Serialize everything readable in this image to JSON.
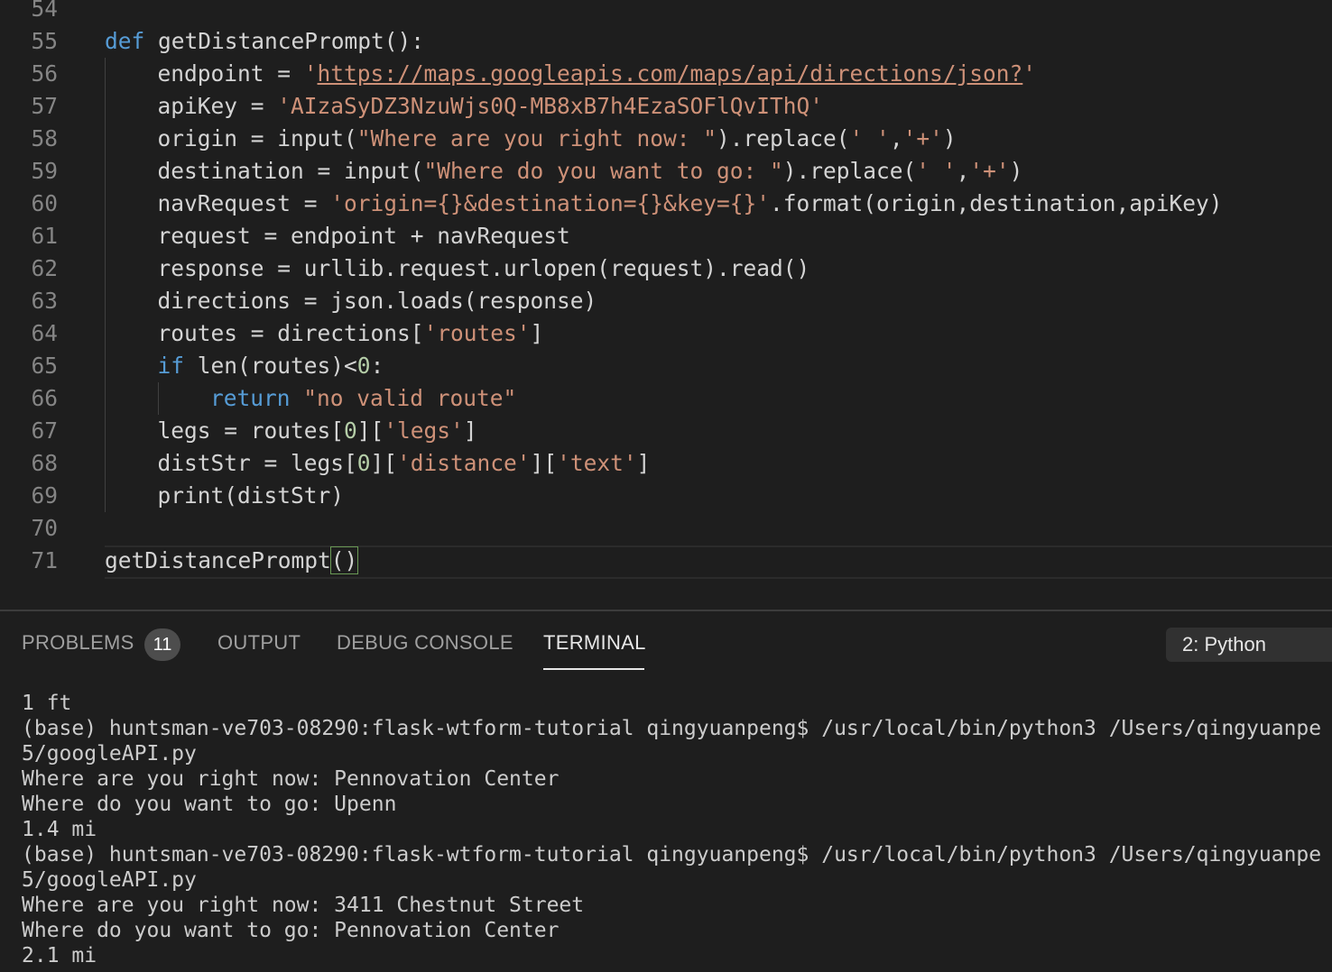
{
  "editor": {
    "lines": [
      {
        "n": "54",
        "segs": []
      },
      {
        "n": "55",
        "segs": [
          [
            "kw",
            "def"
          ],
          [
            "",
            "getDistancePrompt():"
          ]
        ]
      },
      {
        "n": "56",
        "segs": [
          [
            "",
            "endpoint = "
          ],
          [
            "str",
            "'"
          ],
          [
            "url",
            "https://maps.googleapis.com/maps/api/directions/json?"
          ],
          [
            "str",
            "'"
          ]
        ]
      },
      {
        "n": "57",
        "segs": [
          [
            "",
            "apiKey = "
          ],
          [
            "str",
            "'AIzaSyDZ3NzuWjs0Q-MB8xB7h4EzaSOFlQvIThQ'"
          ]
        ]
      },
      {
        "n": "58",
        "segs": [
          [
            "",
            "origin = input("
          ],
          [
            "str",
            "\"Where are you right now: \""
          ],
          [
            "",
            ").replace("
          ],
          [
            "str",
            "' '"
          ],
          [
            "",
            ","
          ],
          [
            "str",
            "'+'"
          ],
          [
            "",
            ")"
          ]
        ]
      },
      {
        "n": "59",
        "segs": [
          [
            "",
            "destination = input("
          ],
          [
            "str",
            "\"Where do you want to go: \""
          ],
          [
            "",
            ").replace("
          ],
          [
            "str",
            "' '"
          ],
          [
            "",
            ","
          ],
          [
            "str",
            "'+'"
          ],
          [
            "",
            ")"
          ]
        ]
      },
      {
        "n": "60",
        "segs": [
          [
            "",
            "navRequest = "
          ],
          [
            "str",
            "'origin={}&destination={}&key={}'"
          ],
          [
            "",
            ".format(origin,destination,apiKey)"
          ]
        ]
      },
      {
        "n": "61",
        "segs": [
          [
            "",
            "request = endpoint + navRequest"
          ]
        ]
      },
      {
        "n": "62",
        "segs": [
          [
            "",
            "response = urllib.request.urlopen(request).read()"
          ]
        ]
      },
      {
        "n": "63",
        "segs": [
          [
            "",
            "directions = json.loads(response)"
          ]
        ]
      },
      {
        "n": "64",
        "segs": [
          [
            "",
            "routes = directions["
          ],
          [
            "str",
            "'routes'"
          ],
          [
            "",
            "]"
          ]
        ]
      },
      {
        "n": "65",
        "segs": [
          [
            "kw",
            "if"
          ],
          [
            "",
            "len(routes)<"
          ],
          [
            "num",
            "0"
          ],
          [
            "",
            ":"
          ]
        ]
      },
      {
        "n": "66",
        "segs": [
          [
            "kw",
            "return"
          ],
          [
            "str",
            "\"no valid route\""
          ]
        ]
      },
      {
        "n": "67",
        "segs": [
          [
            "",
            "legs = routes["
          ],
          [
            "num",
            "0"
          ],
          [
            "",
            "]["
          ],
          [
            "str",
            "'legs'"
          ],
          [
            "",
            "]"
          ]
        ]
      },
      {
        "n": "68",
        "segs": [
          [
            "",
            "distStr = legs["
          ],
          [
            "num",
            "0"
          ],
          [
            "",
            "]["
          ],
          [
            "str",
            "'distance'"
          ],
          [
            "",
            "]["
          ],
          [
            "str",
            "'text'"
          ],
          [
            "",
            "]"
          ]
        ]
      },
      {
        "n": "69",
        "segs": [
          [
            "",
            "print(distStr)"
          ]
        ]
      },
      {
        "n": "70",
        "segs": []
      },
      {
        "n": "71",
        "segs": [
          [
            "",
            "getDistancePrompt"
          ],
          [
            "bm",
            "()"
          ]
        ]
      }
    ]
  },
  "panel": {
    "tabs": {
      "problems": "PROBLEMS",
      "problems_count": "11",
      "output": "OUTPUT",
      "debug_console": "DEBUG CONSOLE",
      "terminal": "TERMINAL"
    },
    "terminal_selector": "2: Python",
    "terminal_lines": [
      "1 ft",
      "(base) huntsman-ve703-08290:flask-wtform-tutorial qingyuanpeng$ /usr/local/bin/python3 /Users/qingyuanpe",
      "5/googleAPI.py",
      "Where are you right now: Pennovation Center",
      "Where do you want to go: Upenn",
      "1.4 mi",
      "(base) huntsman-ve703-08290:flask-wtform-tutorial qingyuanpeng$ /usr/local/bin/python3 /Users/qingyuanpe",
      "5/googleAPI.py",
      "Where are you right now: 3411 Chestnut Street",
      "Where do you want to go: Pennovation Center",
      "2.1 mi"
    ]
  }
}
